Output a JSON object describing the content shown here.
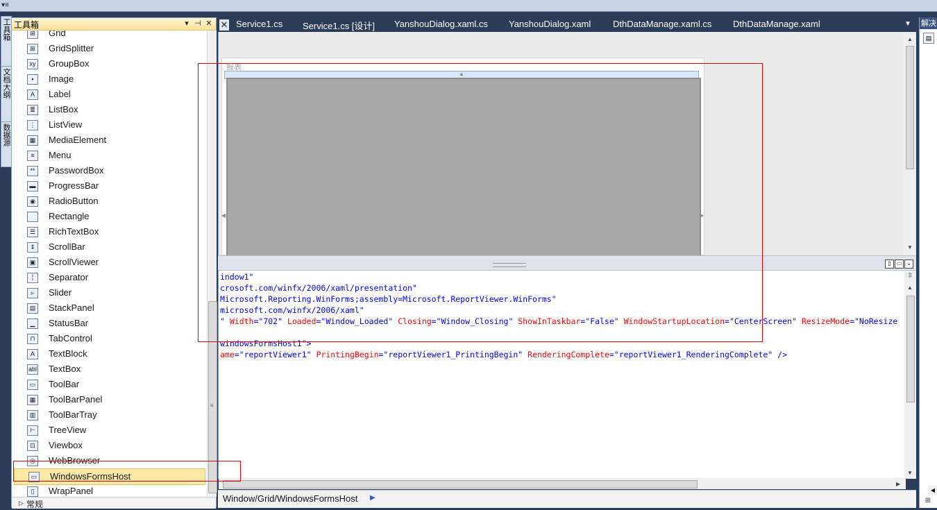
{
  "toolbox": {
    "title": "工具箱",
    "pin_label": "▾ ⊣",
    "close_label": "✕",
    "partial_item": "Grid",
    "items": [
      {
        "label": "GridSplitter",
        "icon": "gridsplitter-icon",
        "glyph": "⊞"
      },
      {
        "label": "GroupBox",
        "icon": "groupbox-icon",
        "glyph": "xy"
      },
      {
        "label": "Image",
        "icon": "image-icon",
        "glyph": "▪"
      },
      {
        "label": "Label",
        "icon": "label-icon",
        "glyph": "A"
      },
      {
        "label": "ListBox",
        "icon": "listbox-icon",
        "glyph": "≣"
      },
      {
        "label": "ListView",
        "icon": "listview-icon",
        "glyph": "⋮"
      },
      {
        "label": "MediaElement",
        "icon": "mediaelement-icon",
        "glyph": "▦"
      },
      {
        "label": "Menu",
        "icon": "menu-icon",
        "glyph": "≡"
      },
      {
        "label": "PasswordBox",
        "icon": "passwordbox-icon",
        "glyph": "**"
      },
      {
        "label": "ProgressBar",
        "icon": "progressbar-icon",
        "glyph": "▬"
      },
      {
        "label": "RadioButton",
        "icon": "radiobutton-icon",
        "glyph": "◉"
      },
      {
        "label": "Rectangle",
        "icon": "rectangle-icon",
        "glyph": ""
      },
      {
        "label": "RichTextBox",
        "icon": "richtextbox-icon",
        "glyph": "☰"
      },
      {
        "label": "ScrollBar",
        "icon": "scrollbar-icon",
        "glyph": "⇕"
      },
      {
        "label": "ScrollViewer",
        "icon": "scrollviewer-icon",
        "glyph": "▣"
      },
      {
        "label": "Separator",
        "icon": "separator-icon",
        "glyph": "╎"
      },
      {
        "label": "Slider",
        "icon": "slider-icon",
        "glyph": "▹"
      },
      {
        "label": "StackPanel",
        "icon": "stackpanel-icon",
        "glyph": "▤"
      },
      {
        "label": "StatusBar",
        "icon": "statusbar-icon",
        "glyph": "▁"
      },
      {
        "label": "TabControl",
        "icon": "tabcontrol-icon",
        "glyph": "⊓"
      },
      {
        "label": "TextBlock",
        "icon": "textblock-icon",
        "glyph": "A"
      },
      {
        "label": "TextBox",
        "icon": "textbox-icon",
        "glyph": "abl"
      },
      {
        "label": "ToolBar",
        "icon": "toolbar-icon",
        "glyph": "▭"
      },
      {
        "label": "ToolBarPanel",
        "icon": "toolbarpanel-icon",
        "glyph": "▦"
      },
      {
        "label": "ToolBarTray",
        "icon": "toolbartray-icon",
        "glyph": "▥"
      },
      {
        "label": "TreeView",
        "icon": "treeview-icon",
        "glyph": "⊢"
      },
      {
        "label": "Viewbox",
        "icon": "viewbox-icon",
        "glyph": "⊡"
      },
      {
        "label": "WebBrowser",
        "icon": "webbrowser-icon",
        "glyph": "◎"
      },
      {
        "label": "WindowsFormsHost",
        "icon": "windowsformshost-icon",
        "glyph": "▭"
      },
      {
        "label": "WrapPanel",
        "icon": "wrappanel-icon",
        "glyph": "▯"
      }
    ],
    "footer_group": "常规"
  },
  "left_rail": {
    "tabs": [
      "工具箱",
      "文档大纲",
      "数据源"
    ]
  },
  "tabs": [
    {
      "label": "Service1.cs"
    },
    {
      "label": "Service1.cs [设计]"
    },
    {
      "label": "YanshouDialog.xaml.cs"
    },
    {
      "label": "YanshouDialog.xaml"
    },
    {
      "label": "DthDataManage.xaml.cs"
    },
    {
      "label": "DthDataManage.xaml"
    }
  ],
  "designer": {
    "window_label": "报表"
  },
  "xaml_lines": [
    [
      {
        "t": "indow1\"",
        "c": "b"
      }
    ],
    [
      {
        "t": "crosoft.com/winfx/2006/xaml/presentation\"",
        "c": "b"
      }
    ],
    [
      {
        "t": "Microsoft.Reporting.WinForms;assembly=Microsoft.ReportViewer.WinForms\"",
        "c": "b"
      }
    ],
    [
      {
        "t": "microsoft.com/winfx/2006/xaml\"",
        "c": "b"
      }
    ],
    [
      {
        "t": "\" ",
        "c": "b"
      },
      {
        "t": "Width",
        "c": "r"
      },
      {
        "t": "=\"702\" ",
        "c": "b"
      },
      {
        "t": "Loaded",
        "c": "r"
      },
      {
        "t": "=\"Window_Loaded\" ",
        "c": "b"
      },
      {
        "t": "Closing",
        "c": "r"
      },
      {
        "t": "=\"Window_Closing\" ",
        "c": "b"
      },
      {
        "t": "ShowInTaskbar",
        "c": "r"
      },
      {
        "t": "=\"False\" ",
        "c": "b"
      },
      {
        "t": "WindowStartupLocation",
        "c": "r"
      },
      {
        "t": "=\"CenterScreen\" ",
        "c": "b"
      },
      {
        "t": "ResizeMode",
        "c": "r"
      },
      {
        "t": "=\"NoResize",
        "c": "b"
      }
    ],
    [],
    [
      {
        "t": "windowsFormsHost1\">",
        "c": "b"
      }
    ],
    [
      {
        "t": "ame",
        "c": "r"
      },
      {
        "t": "=\"reportViewer1\" ",
        "c": "b"
      },
      {
        "t": "PrintingBegin",
        "c": "r"
      },
      {
        "t": "=\"reportViewer1_PrintingBegin\" ",
        "c": "b"
      },
      {
        "t": "RenderingComplete",
        "c": "r"
      },
      {
        "t": "=\"reportViewer1_RenderingComplete\" />",
        "c": "b"
      }
    ]
  ],
  "breadcrumb": {
    "path": "Window/Grid/WindowsFormsHost"
  },
  "right_panel": {
    "title": "解决"
  },
  "colors": {
    "chrome": "#2b3c59",
    "xaml_attr": "#ff0000",
    "xaml_value": "#0000ff",
    "selection": "#fde8a4",
    "annotation": "#e00000"
  }
}
